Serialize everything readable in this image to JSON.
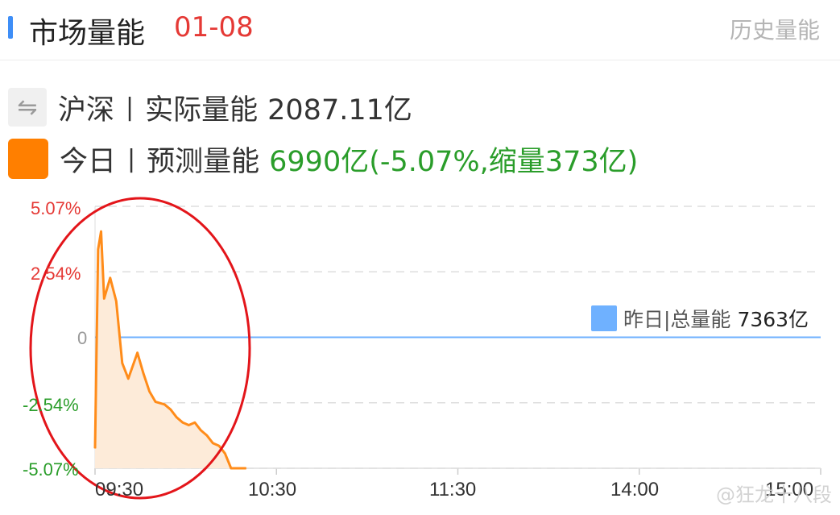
{
  "header": {
    "title": "市场量能",
    "date": "01-08",
    "history_button": "历史量能"
  },
  "legend": {
    "row1": {
      "icon": "swap-icon",
      "label": "沪深",
      "separator": "|",
      "metric": "实际量能",
      "value": "2087.11亿"
    },
    "row2": {
      "icon": "orange-square",
      "label": "今日",
      "separator": "|",
      "metric": "预测量能",
      "value": "6990亿(-5.07%,缩量373亿)"
    }
  },
  "yesterday": {
    "label": "昨日|总量能",
    "value": "7363亿"
  },
  "watermark": "@狂龙十八段",
  "colors": {
    "accent": "#3e8ef7",
    "date": "#e53935",
    "line": "#ff8c1a",
    "area": "#fdebd9",
    "baseline": "#6fb1ff",
    "positive": "#e53935",
    "negative": "#2a9d2a"
  },
  "chart_data": {
    "type": "area",
    "y_labels": [
      "5.07%",
      "2.54%",
      "0",
      "-2.54%",
      "-5.07%"
    ],
    "x_labels": [
      "09:30",
      "10:30",
      "11:30",
      "14:00",
      "15:00"
    ],
    "ylim": [
      -5.07,
      5.07
    ],
    "grid": true,
    "series": [
      {
        "x": [
          "09:30",
          "09:31",
          "09:32",
          "09:33",
          "09:35",
          "09:37",
          "09:39",
          "09:41",
          "09:44",
          "09:46",
          "09:48",
          "09:50",
          "09:53",
          "09:55",
          "09:57",
          "09:59",
          "10:01",
          "10:03",
          "10:05",
          "10:07",
          "10:09",
          "10:11",
          "10:13",
          "10:15",
          "10:17",
          "10:19",
          "10:20"
        ],
        "values": [
          -4.3,
          3.4,
          4.1,
          1.5,
          2.3,
          1.4,
          -1.0,
          -1.6,
          -0.6,
          -1.4,
          -2.1,
          -2.5,
          -2.6,
          -2.8,
          -3.1,
          -3.3,
          -3.4,
          -3.3,
          -3.6,
          -3.8,
          -4.1,
          -4.2,
          -4.5,
          -5.07,
          -5.07,
          -5.07,
          -5.07
        ]
      }
    ]
  }
}
